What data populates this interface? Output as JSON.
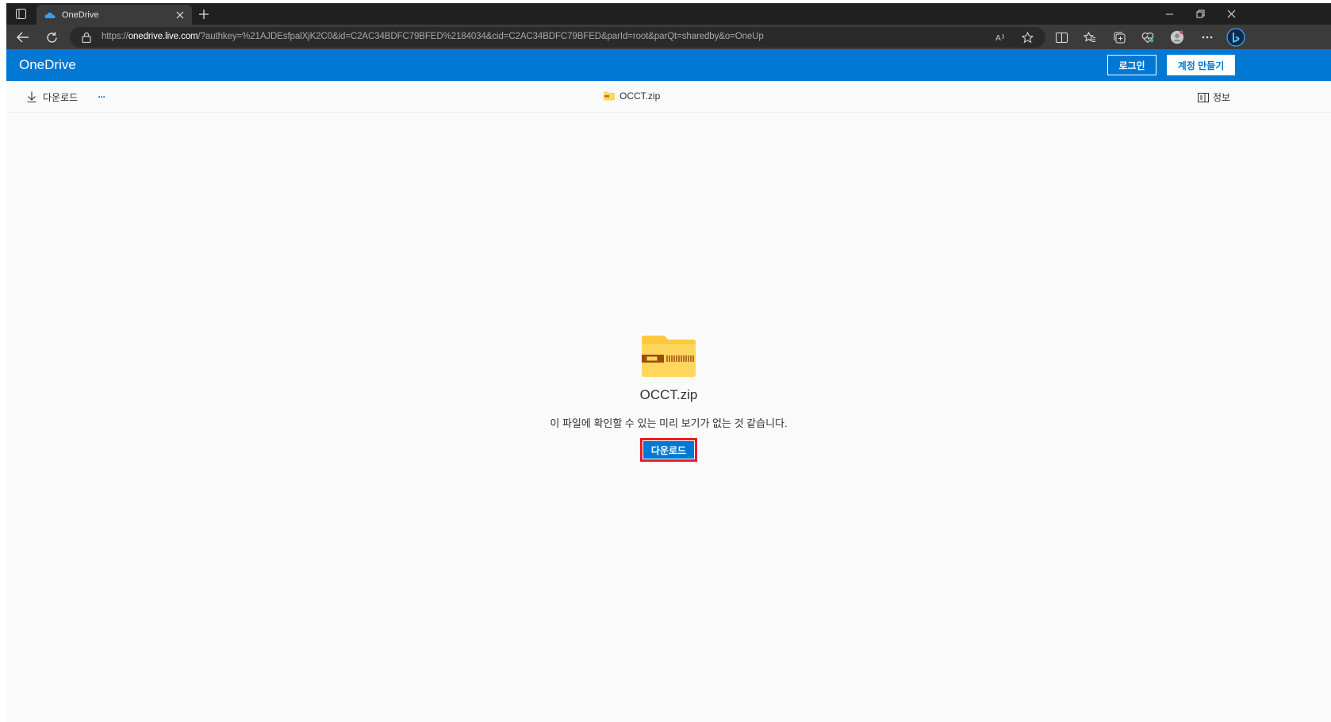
{
  "browser": {
    "tab": {
      "title": "OneDrive"
    },
    "address": {
      "url_prefix": "https://",
      "url_host": "onedrive.live.com",
      "url_path": "/?authkey=%21AJDEsfpalXjK2C0&id=C2AC34BDFC79BFED%2184034&cid=C2AC34BDFC79BFED&parId=root&parQt=sharedby&o=OneUp"
    },
    "icons": {
      "tab_actions": "tab-actions-icon",
      "tab_favicon": "onedrive-cloud-icon",
      "tab_close": "close-icon",
      "new_tab": "plus-icon",
      "minimize": "minimize-icon",
      "restore": "restore-icon",
      "close_window": "close-icon",
      "back": "back-arrow-icon",
      "refresh": "refresh-icon",
      "lock": "lock-icon",
      "read_aloud": "read-aloud-icon",
      "favorite": "star-icon",
      "split_screen": "split-screen-icon",
      "favorites": "favorites-icon",
      "collections": "collections-icon",
      "performance": "heart-pulse-icon",
      "profile": "profile-avatar-icon",
      "settings_more": "more-icon",
      "copilot": "copilot-icon"
    }
  },
  "onedrive": {
    "brand": "OneDrive",
    "signin_label": "로그인",
    "signup_label": "계정 만들기",
    "command_bar": {
      "download_label": "다운로드",
      "more_label": "···",
      "file_name": "OCCT.zip",
      "info_label": "정보"
    },
    "preview": {
      "file_name": "OCCT.zip",
      "message": "이 파일에 확인할 수 있는 미리 보기가 없는 것 같습니다.",
      "download_button_label": "다운로드"
    }
  },
  "colors": {
    "brand_blue": "#0078d4",
    "highlight_red": "#e21d2a",
    "folder_yellow": "#ffd75e"
  }
}
